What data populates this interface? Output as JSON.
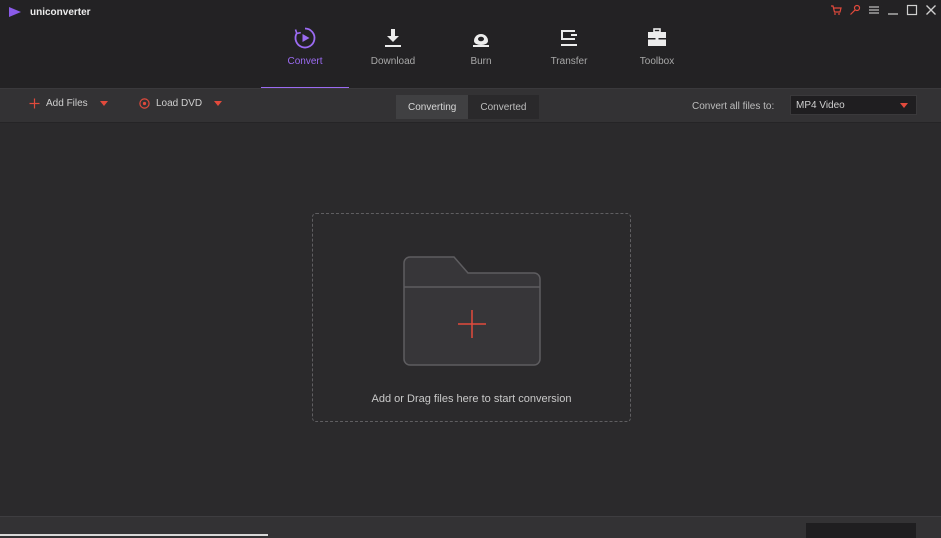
{
  "app": {
    "title": "uniconverter"
  },
  "colors": {
    "accent": "#9b6bf2",
    "red": "#e24a3c"
  },
  "nav": [
    {
      "label": "Convert",
      "icon": "convert-icon",
      "active": true
    },
    {
      "label": "Download",
      "icon": "download-icon",
      "active": false
    },
    {
      "label": "Burn",
      "icon": "burn-icon",
      "active": false
    },
    {
      "label": "Transfer",
      "icon": "transfer-icon",
      "active": false
    },
    {
      "label": "Toolbox",
      "icon": "toolbox-icon",
      "active": false
    }
  ],
  "toolbar": {
    "add_files": "Add Files",
    "load_dvd": "Load DVD",
    "tabs": [
      {
        "label": "Converting",
        "active": true
      },
      {
        "label": "Converted",
        "active": false
      }
    ],
    "convert_all_label": "Convert all files to:",
    "format_value": "MP4 Video"
  },
  "dropzone": {
    "text": "Add or Drag files here to start conversion"
  }
}
